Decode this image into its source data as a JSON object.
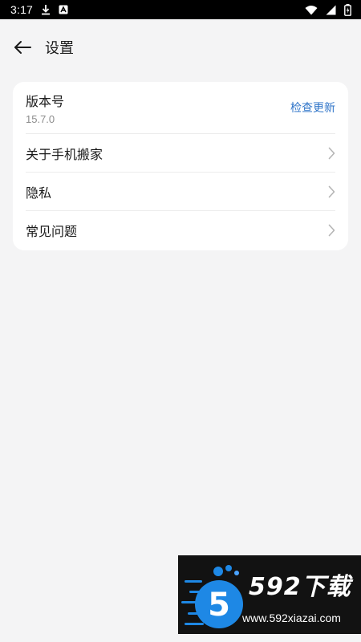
{
  "status_bar": {
    "time": "3:17"
  },
  "header": {
    "title": "设置"
  },
  "card": {
    "version": {
      "label": "版本号",
      "value": "15.7.0",
      "action_label": "检查更新"
    },
    "items": [
      {
        "label": "关于手机搬家",
        "icon": "chevron-right-icon"
      },
      {
        "label": "隐私",
        "icon": "chevron-right-icon"
      },
      {
        "label": "常见问题",
        "icon": "chevron-right-icon"
      }
    ]
  },
  "colors": {
    "background": "#f4f4f5",
    "card": "#ffffff",
    "accent_link": "#2f74c8",
    "secondary_text": "#8c8c8c",
    "primary_text": "#1a1a1a"
  },
  "watermark": {
    "brand": "592下载",
    "url": "www.592xiazai.com",
    "logo_digit": "5"
  }
}
